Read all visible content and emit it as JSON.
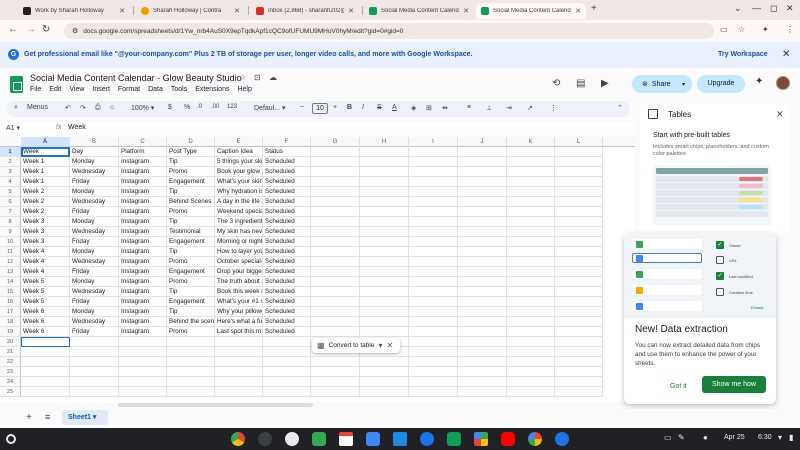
{
  "browser": {
    "tabs": [
      {
        "title": "Work by Sharah Holloway",
        "fav": "#222222",
        "active": false
      },
      {
        "title": "Sharah Holloway | Contra",
        "fav": "#f2a000",
        "active": false
      },
      {
        "title": "Inbox (2,868) - sharahh202@g",
        "fav": "#d93025",
        "active": false
      },
      {
        "title": "Social Media Content Calenda",
        "fav": "#0f9d58",
        "active": false
      },
      {
        "title": "Social Media Content Calenda",
        "fav": "#0f9d58",
        "active": true
      }
    ],
    "url": "docs.google.com/spreadsheets/d/1Yw_nrb4AuS0X9epTqdkApf1cQC9ofUFUMU9MHuV0hyM/edit?gid=0#gid=0"
  },
  "promo": {
    "text": "Get professional email like \"@your-company.com\" Plus 2 TB of storage per user, longer video calls, and more with Google Workspace.",
    "action": "Try Workspace"
  },
  "doc": {
    "title": "Social Media Content Calendar - Glow Beauty Studio",
    "menu": [
      "File",
      "Edit",
      "View",
      "Insert",
      "Format",
      "Data",
      "Tools",
      "Extensions",
      "Help"
    ],
    "share_label": "Share",
    "upgrade_label": "Upgrade"
  },
  "toolbar": {
    "menus_label": "Menus",
    "zoom": "100%",
    "currency": "$",
    "percent": "%",
    "dec_less": ".0",
    "dec_more": ".00",
    "number_format": "123",
    "font": "Defaul...",
    "font_size": "10"
  },
  "formula_bar": {
    "cell_ref": "A1",
    "value": "Week"
  },
  "grid": {
    "columns": [
      "A",
      "B",
      "C",
      "D",
      "E",
      "F",
      "G",
      "H",
      "I",
      "J",
      "K",
      "L"
    ],
    "row_numbers": [
      "1",
      "2",
      "3",
      "4",
      "5",
      "6",
      "7",
      "8",
      "9",
      "10",
      "11",
      "12",
      "13",
      "14",
      "15",
      "16",
      "17",
      "18",
      "19",
      "20",
      "21",
      "22",
      "23",
      "24",
      "25"
    ],
    "rows": [
      [
        "Week",
        "Day",
        "Platform",
        "Post Type",
        "Caption Idea",
        "Status"
      ],
      [
        "Week 1",
        "Monday",
        "Instagram",
        "Tip",
        "5 things your ski",
        "Scheduled"
      ],
      [
        "Week 1",
        "Wednesday",
        "Instagram",
        "Promo",
        "Book your glow t",
        "Scheduled"
      ],
      [
        "Week 1",
        "Friday",
        "Instagram",
        "Engagement",
        "What's your skin",
        "Scheduled"
      ],
      [
        "Week 2",
        "Monday",
        "Instagram",
        "Tip",
        "Why hydration is",
        "Scheduled"
      ],
      [
        "Week 2",
        "Wednesday",
        "Instagram",
        "Behind Scenes",
        "A day in the life a",
        "Scheduled"
      ],
      [
        "Week 2",
        "Friday",
        "Instagram",
        "Promo",
        "Weekend specia",
        "Scheduled"
      ],
      [
        "Week 3",
        "Monday",
        "Instagram",
        "Tip",
        "The 3 ingredient",
        "Scheduled"
      ],
      [
        "Week 3",
        "Wednesday",
        "Instagram",
        "Testimonial",
        "My skin has nev",
        "Scheduled"
      ],
      [
        "Week 3",
        "Friday",
        "Instagram",
        "Engagement",
        "Morning or night",
        "Scheduled"
      ],
      [
        "Week 4",
        "Monday",
        "Instagram",
        "Tip",
        "How to layer you",
        "Scheduled"
      ],
      [
        "Week 4",
        "Wednesday",
        "Instagram",
        "Promo",
        "October special-",
        "Scheduled"
      ],
      [
        "Week 4",
        "Friday",
        "Instagram",
        "Engagement",
        "Drop your bigge:",
        "Scheduled"
      ],
      [
        "Week 5",
        "Monday",
        "Instagram",
        "Promo",
        "The truth about i",
        "Scheduled"
      ],
      [
        "Week 5",
        "Wednesday",
        "Instagram",
        "Tip",
        "Book this week a",
        "Scheduled"
      ],
      [
        "Week 5",
        "Friday",
        "Instagram",
        "Engagement",
        "What's your #1 s",
        "Scheduled"
      ],
      [
        "Week 6",
        "Monday",
        "Instagram",
        "Tip",
        "Why your pillowc",
        "Scheduled"
      ],
      [
        "Week 6",
        "Wednesday",
        "Instagram",
        "Behind the scen",
        "Here's what a fu",
        "Scheduled"
      ],
      [
        "Week 6",
        "Friday",
        "Instagram",
        "Promo",
        "Last spot this m",
        "Scheduled"
      ]
    ],
    "convert_label": "Convert to table"
  },
  "side_panel": {
    "title": "Tables",
    "subtitle": "Start with pre-built tables",
    "description": "Includes smart chips, placeholders, and custom color palettes"
  },
  "popup": {
    "options": [
      "Owner",
      "URL",
      "Last modified",
      "Creation time"
    ],
    "options_checked": [
      true,
      false,
      true,
      false
    ],
    "extract_label": "Extract",
    "title": "New! Data extraction",
    "body": "You can now extract detailed data from chips and use them to enhance the power of your sheets.",
    "got_it": "Got it",
    "show_me": "Show me how"
  },
  "sheets": {
    "active": "Sheet1"
  },
  "taskbar": {
    "date": "Apr 25",
    "time": "6:30"
  }
}
